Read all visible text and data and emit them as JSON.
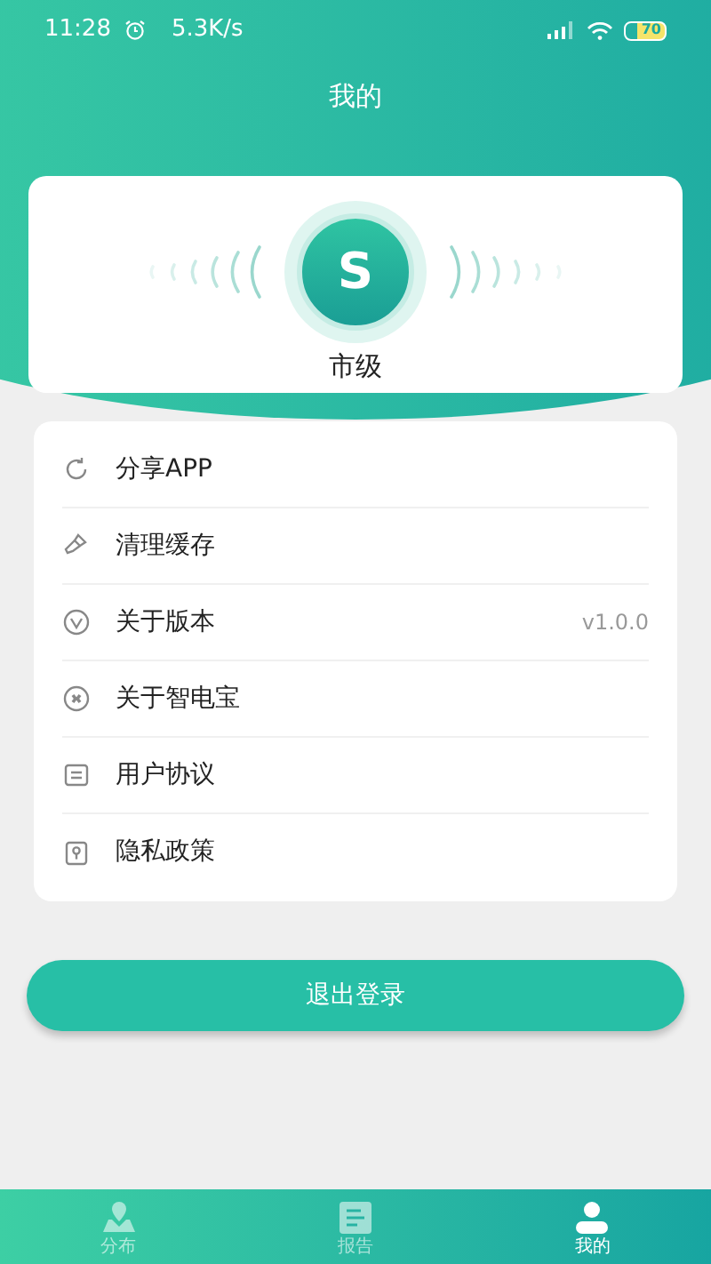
{
  "status_bar": {
    "time": "11:28",
    "speed": "5.3K/s",
    "battery": "70"
  },
  "header": {
    "title": "我的"
  },
  "profile": {
    "avatar_letter": "S",
    "level": "市级"
  },
  "menu": [
    {
      "label": "分享APP"
    },
    {
      "label": "清理缓存"
    },
    {
      "label": "关于版本",
      "value": "v1.0.0"
    },
    {
      "label": "关于智电宝"
    },
    {
      "label": "用户协议"
    },
    {
      "label": "隐私政策"
    }
  ],
  "logout_button": "退出登录",
  "tabs": [
    {
      "label": "分布",
      "selected": false
    },
    {
      "label": "报告",
      "selected": false
    },
    {
      "label": "我的",
      "selected": true
    }
  ]
}
